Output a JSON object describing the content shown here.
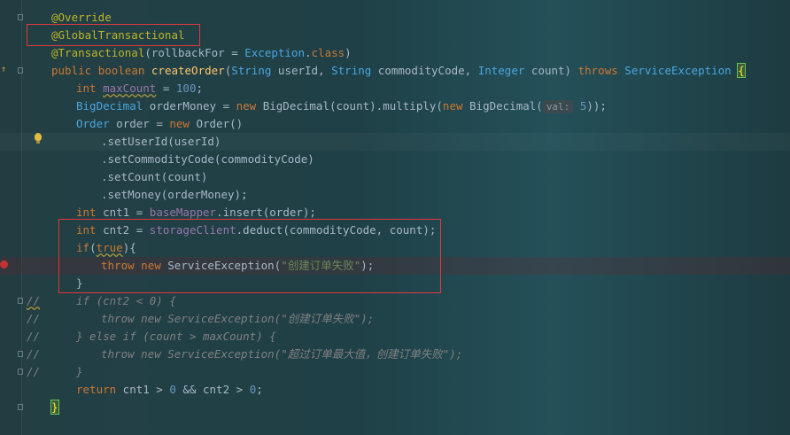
{
  "hint_label": "val:",
  "lines": {
    "l1": "@Override",
    "l2": "@GlobalTransactional",
    "l3a": "@Transactional",
    "l3b": "(rollbackFor = ",
    "l3c": "Exception",
    "l3d": ".",
    "l3e": "class",
    "l3f": ")",
    "l4_kw1": "public",
    "l4_kw2": "boolean",
    "l4_fn": "createOrder",
    "l4_t1": "String",
    "l4_p1": " userId, ",
    "l4_t2": "String",
    "l4_p2": " commodityCode, ",
    "l4_t3": "Integer",
    "l4_p3": " count) ",
    "l4_kw3": "throws",
    "l4_t4": "ServiceException",
    "l4_brace": "{",
    "l5_kw": "int",
    "l5_var": "maxCount",
    "l5_eq": " = ",
    "l5_num": "100",
    "l5_end": ";",
    "l6_t": "BigDecimal",
    "l6_a": " orderMoney = ",
    "l6_kw": "new",
    "l6_b": " BigDecimal(count).multiply(",
    "l6_kw2": "new",
    "l6_c": " BigDecimal(",
    "l6_num": "5",
    "l6_d": "));",
    "l7_t": "Order",
    "l7_a": " order = ",
    "l7_kw": "new",
    "l7_b": " Order()",
    "l8": ".setUserId(userId)",
    "l9": ".setCommodityCode(commodityCode)",
    "l10": ".setCount(count)",
    "l11": ".setMoney(orderMoney);",
    "l12_kw": "int",
    "l12_a": " cnt1 = ",
    "l12_f": "baseMapper",
    "l12_b": ".insert(order);",
    "l13_kw": "int",
    "l13_a": " cnt2 = ",
    "l13_f": "storageClient",
    "l13_b": ".deduct(commodityCode, count);",
    "l14_kw": "if",
    "l14_a": "(",
    "l14_kw2": "true",
    "l14_b": "){",
    "l15_kw1": "throw",
    "l15_kw2": "new",
    "l15_a": " ServiceException(",
    "l15_str": "\"创建订单失败\"",
    "l15_b": ");",
    "l16": "}",
    "l17_c": "//",
    "l17": "if (cnt2 < 0) {",
    "l18_c": "//",
    "l18": "throw new ServiceException(\"创建订单失败\");",
    "l19_c": "//",
    "l19": "} else if (count > maxCount) {",
    "l20_c": "//",
    "l20": "throw new ServiceException(\"超过订单最大值，创建订单失败\");",
    "l21_c": "//",
    "l21": "}",
    "l22_kw": "return",
    "l22_a": " cnt1 > ",
    "l22_n1": "0",
    "l22_b": " && cnt2 > ",
    "l22_n2": "0",
    "l22_c": ";",
    "l23": "}"
  },
  "colors": {
    "highlight_box": "#e0393e",
    "keyword": "#cc7832",
    "annotation": "#bbb529",
    "type": "#4aa6e0",
    "string": "#6a8759",
    "number": "#6897bb"
  }
}
